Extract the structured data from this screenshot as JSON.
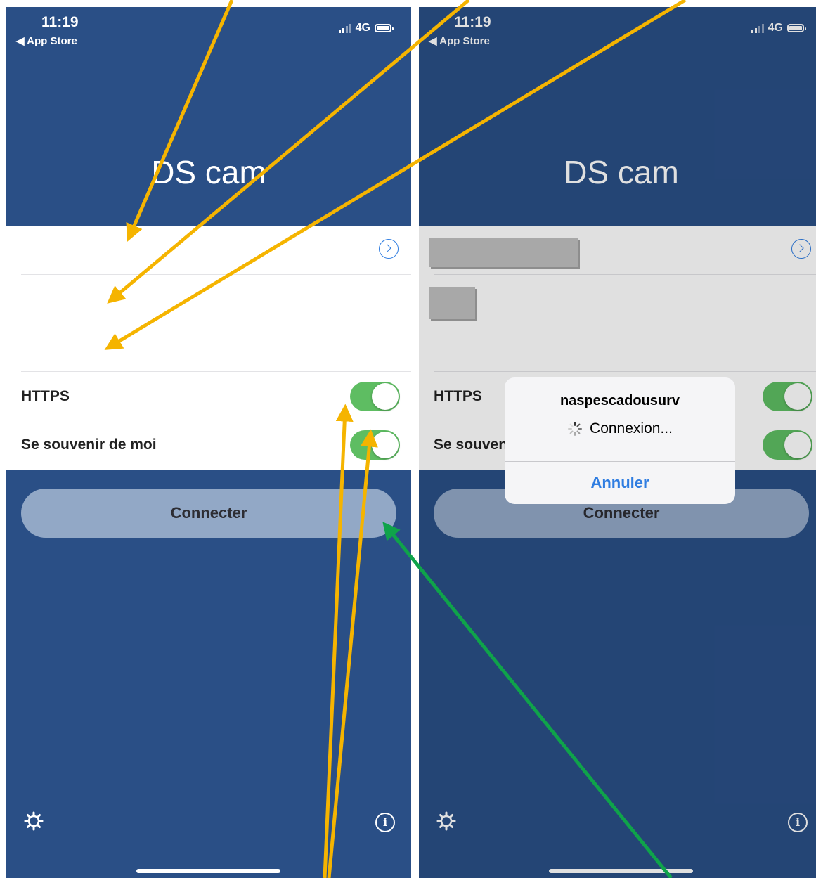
{
  "status": {
    "time": "11:19",
    "back": "◀ App Store",
    "network": "4G"
  },
  "app": {
    "title": "DS cam"
  },
  "form": {
    "https_label": "HTTPS",
    "remember_label": "Se souvenir de moi",
    "https_on": true,
    "remember_on": true
  },
  "connect_label": "Connecter",
  "alert": {
    "title": "naspescadousurv",
    "message": "Connexion...",
    "cancel": "Annuler"
  },
  "colors": {
    "background": "#2a4f86",
    "toggle": "#5ebd62",
    "accent": "#2f7de1",
    "arrow_yellow": "#f5b400",
    "arrow_green": "#0fa34a"
  },
  "icons": {
    "settings": "gear-icon",
    "info": "info-icon",
    "chevron": "chevron-circle-icon",
    "spinner": "spinner-icon"
  }
}
